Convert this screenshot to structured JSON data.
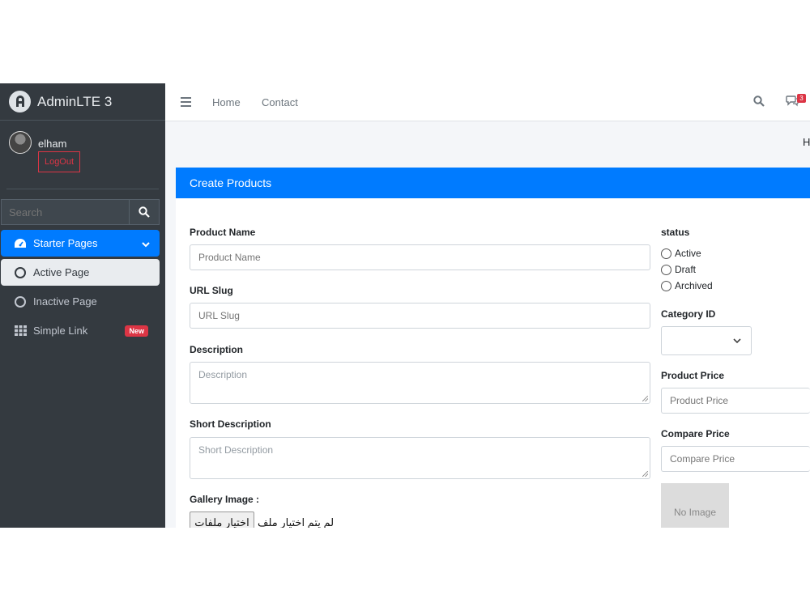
{
  "brand": {
    "name": "AdminLTE 3"
  },
  "user": {
    "name": "elham",
    "logout_label": "LogOut"
  },
  "sidebar": {
    "search_placeholder": "Search",
    "items": [
      {
        "label": "Starter Pages",
        "icon": "tachometer-icon",
        "state": "open"
      },
      {
        "label": "Active Page",
        "icon": "circle-icon",
        "state": "active"
      },
      {
        "label": "Inactive Page",
        "icon": "circle-icon",
        "state": "normal"
      },
      {
        "label": "Simple Link",
        "icon": "grid-icon",
        "badge": "New"
      }
    ]
  },
  "topbar": {
    "links": [
      "Home",
      "Contact"
    ],
    "message_count": "3"
  },
  "breadcrumb": {
    "first": "H"
  },
  "card": {
    "title": "Create Products"
  },
  "form": {
    "product_name": {
      "label": "Product Name",
      "placeholder": "Product Name"
    },
    "url_slug": {
      "label": "URL Slug",
      "placeholder": "URL Slug"
    },
    "description": {
      "label": "Description",
      "placeholder": "Description"
    },
    "short_description": {
      "label": "Short Description",
      "placeholder": "Short Description"
    },
    "gallery": {
      "label": "Gallery Image :",
      "button": "اختيار ملفات",
      "status": "لم يتم اختيار ملف"
    },
    "status": {
      "label": "status",
      "options": [
        "Active",
        "Draft",
        "Archived"
      ]
    },
    "category": {
      "label": "Category ID",
      "value": ""
    },
    "product_price": {
      "label": "Product Price",
      "placeholder": "Product Price"
    },
    "compare_price": {
      "label": "Compare Price",
      "placeholder": "Compare Price"
    },
    "image_placeholder": "No Image"
  },
  "colors": {
    "primary": "#007bff",
    "sidebar": "#343a40",
    "danger": "#dc3545"
  }
}
